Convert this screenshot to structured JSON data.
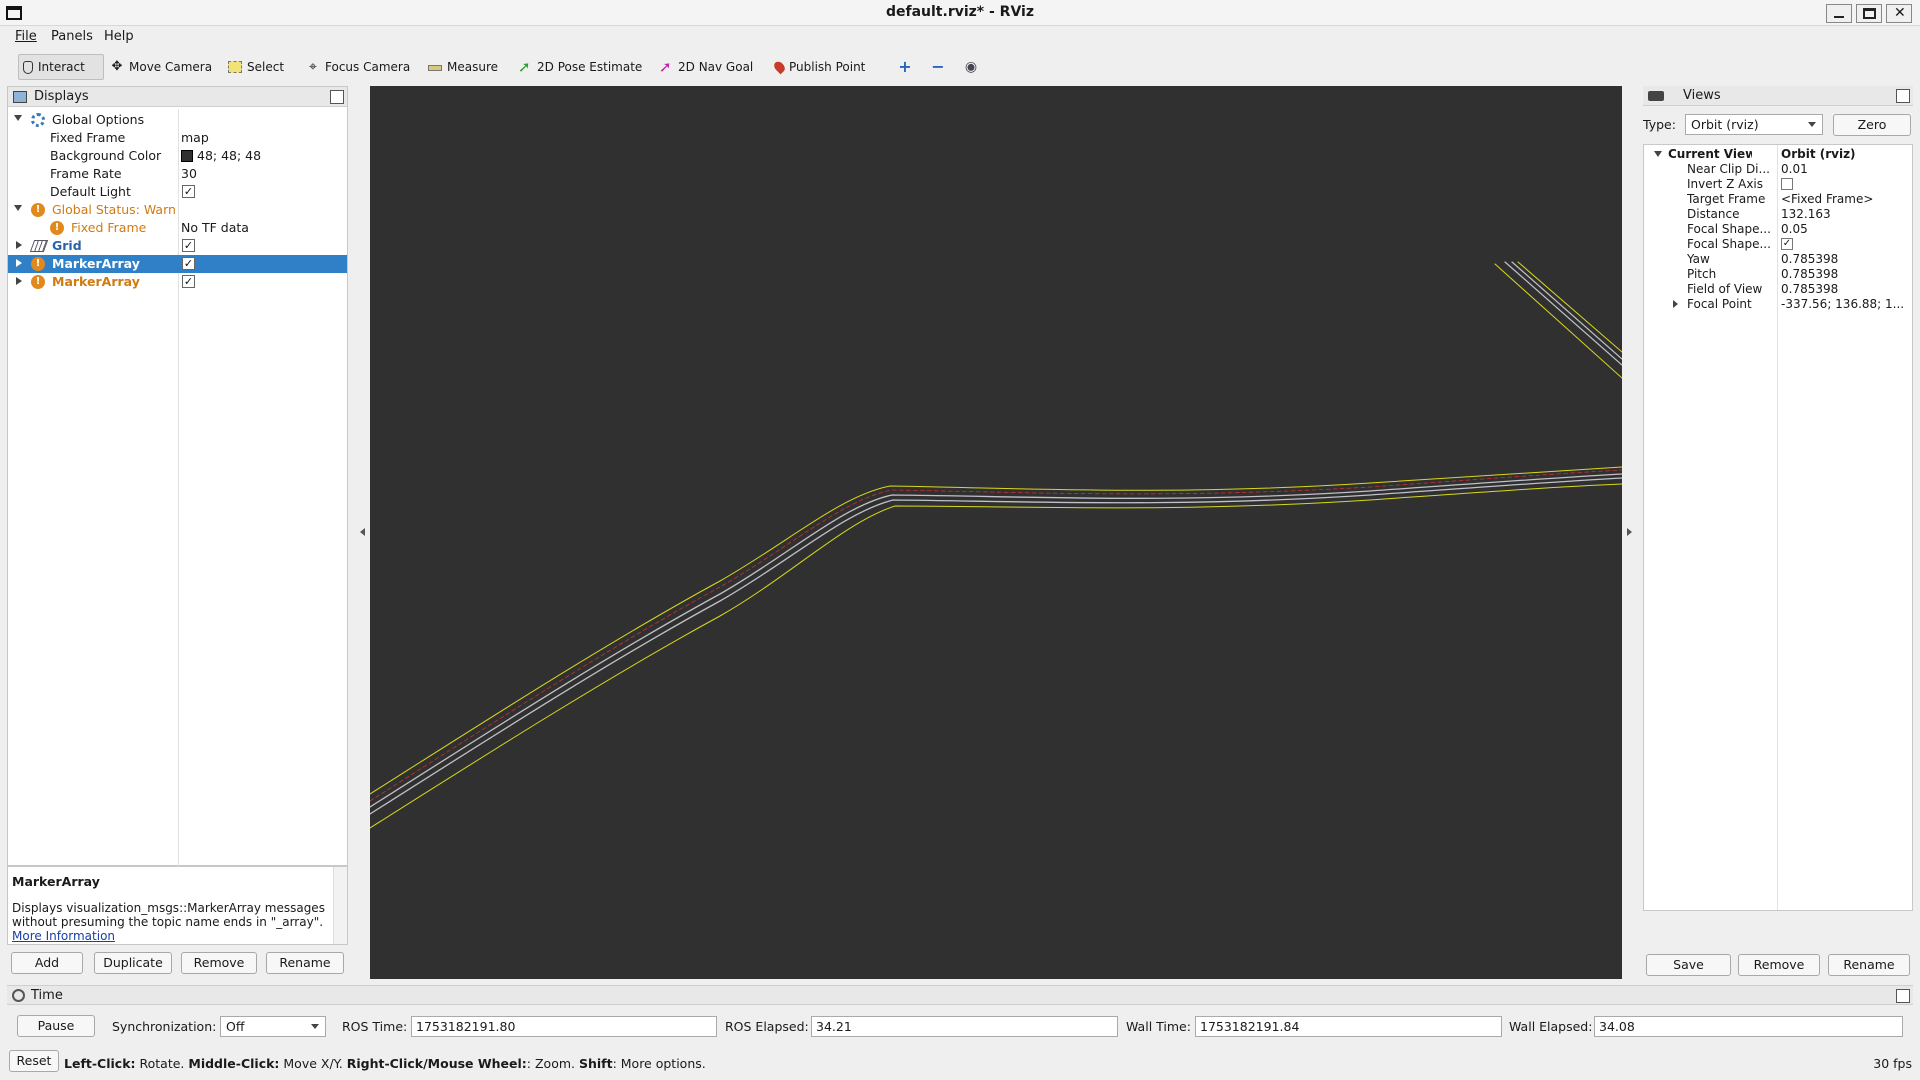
{
  "window": {
    "title": "default.rviz* - RViz"
  },
  "menu": [
    "File",
    "Panels",
    "Help"
  ],
  "toolbar": {
    "interact": "Interact",
    "move_camera": "Move Camera",
    "select": "Select",
    "focus_camera": "Focus Camera",
    "measure": "Measure",
    "pose_estimate": "2D Pose Estimate",
    "nav_goal": "2D Nav Goal",
    "publish_point": "Publish Point"
  },
  "displays": {
    "title": "Displays",
    "rows": [
      {
        "label": "Global Options",
        "value": ""
      },
      {
        "label": "Fixed Frame",
        "value": "map"
      },
      {
        "label": "Background Color",
        "value": "48; 48; 48"
      },
      {
        "label": "Frame Rate",
        "value": "30"
      },
      {
        "label": "Default Light",
        "value": ""
      },
      {
        "label": "Global Status: Warn",
        "value": ""
      },
      {
        "label": "Fixed Frame",
        "value": "No TF data"
      },
      {
        "label": "Grid",
        "value": ""
      },
      {
        "label": "MarkerArray",
        "value": ""
      },
      {
        "label": "MarkerArray",
        "value": ""
      }
    ],
    "description": {
      "heading": "MarkerArray",
      "text": "Displays visualization_msgs::MarkerArray messages without presuming the topic name ends in \"_array\".",
      "link": "More Information"
    },
    "buttons": {
      "add": "Add",
      "duplicate": "Duplicate",
      "remove": "Remove",
      "rename": "Rename"
    }
  },
  "views": {
    "title": "Views",
    "type_label": "Type:",
    "type_value": "Orbit (rviz)",
    "zero": "Zero",
    "current_view": {
      "label": "Current View",
      "value": "Orbit (rviz)"
    },
    "props": [
      {
        "label": "Near Clip Di...",
        "value": "0.01"
      },
      {
        "label": "Invert Z Axis",
        "value": ""
      },
      {
        "label": "Target Frame",
        "value": "<Fixed Frame>"
      },
      {
        "label": "Distance",
        "value": "132.163"
      },
      {
        "label": "Focal Shape...",
        "value": "0.05"
      },
      {
        "label": "Focal Shape...",
        "value": ""
      },
      {
        "label": "Yaw",
        "value": "0.785398"
      },
      {
        "label": "Pitch",
        "value": "0.785398"
      },
      {
        "label": "Field of View",
        "value": "0.785398"
      },
      {
        "label": "Focal Point",
        "value": "-337.56; 136.88; 1..."
      }
    ],
    "buttons": {
      "save": "Save",
      "remove": "Remove",
      "rename": "Rename"
    }
  },
  "time": {
    "title": "Time",
    "pause": "Pause",
    "sync_label": "Synchronization:",
    "sync_value": "Off",
    "ros_time_label": "ROS Time:",
    "ros_time": "1753182191.80",
    "ros_elapsed_label": "ROS Elapsed:",
    "ros_elapsed": "34.21",
    "wall_time_label": "Wall Time:",
    "wall_time": "1753182191.84",
    "wall_elapsed_label": "Wall Elapsed:",
    "wall_elapsed": "34.08"
  },
  "status": {
    "reset": "Reset",
    "hint_left_click": "Left-Click:",
    "hint_rotate": " Rotate. ",
    "hint_middle_click": "Middle-Click:",
    "hint_move": " Move X/Y. ",
    "hint_right_click": "Right-Click/Mouse Wheel:",
    "hint_zoom": ": Zoom. ",
    "hint_shift": "Shift",
    "hint_more": ": More options.",
    "fps": "30 fps"
  },
  "colors": {
    "viewport_bg": "#303030",
    "lane_border": "#d8d820",
    "lane_center": "#c0c0c8",
    "lane_ref": "#c83030",
    "selection": "#3080c8",
    "warn": "#e08a1e"
  }
}
